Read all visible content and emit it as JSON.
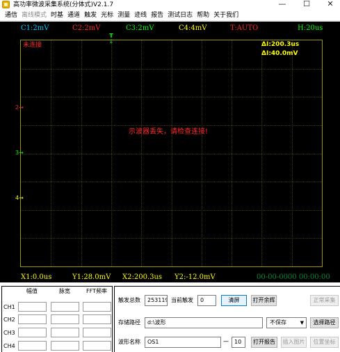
{
  "window": {
    "title": "高功率微波采集系统(分体式)V2.1.7",
    "minimize_glyph": "—",
    "maximize_glyph": "☐",
    "close_glyph": "✕",
    "icon": "app-icon"
  },
  "menu": {
    "items": [
      "通信",
      "离线模式",
      "时基",
      "通道",
      "触发",
      "光标",
      "测量",
      "迹线",
      "报告",
      "测试日志",
      "帮助",
      "关于我们"
    ]
  },
  "scope": {
    "channels": {
      "ch1": "C1:2mV",
      "ch2": "C2:2mV",
      "ch3": "C3:2mV",
      "ch4": "C4:4mV",
      "trigger": "T:AUTO",
      "timebase": "H:20us"
    },
    "status": "未连接",
    "delta_t": "ΔI:200.3us",
    "delta_v": "ΔI:40.0mV",
    "message": "示波器丢失，请检查连接!",
    "trigger_marker": "T",
    "markers": {
      "m2": "2→",
      "m3": "3→",
      "m4": "4→"
    },
    "cursors": {
      "x1": "X1:0.0us",
      "y1": "Y1:28.0mV",
      "x2": "X2:200.3us",
      "y2": "Y2:-12.0mV"
    },
    "timestamp": "00-00-0000 00:00:00",
    "colors": {
      "background": "#000000",
      "ch1": "#00c8ff",
      "ch2": "#ff2a2a",
      "ch3": "#00ff00",
      "ch4": "#ffff00",
      "timebase": "#00ff00",
      "grid_border": "#9a9a00",
      "message": "#ff2a2a",
      "status": "#ff2a2a",
      "timestamp": "#008c3c"
    }
  },
  "measurements": {
    "headers": [
      "幅值",
      "脉宽",
      "FFT频率"
    ],
    "channels": [
      "CH1",
      "CH2",
      "CH3",
      "CH4"
    ]
  },
  "controls": {
    "trigger_total_label": "触发总数",
    "trigger_total_value": "253119",
    "current_trigger_label": "当前触发",
    "current_trigger_value": "0",
    "clear_screen": "清屏",
    "open_afterglow": "打开余辉",
    "normal_acquire": "正常采集",
    "save_path_label": "存储路径",
    "save_path_value": "d:\\波形",
    "save_mode": "不保存",
    "select_path": "选择路径",
    "wave_name_label": "波形名称",
    "wave_name_value": "OS1",
    "dash": "一",
    "index_value": "10",
    "open_report": "打开报告",
    "insert_image": "插入图片",
    "position_screen": "位置坐标"
  }
}
